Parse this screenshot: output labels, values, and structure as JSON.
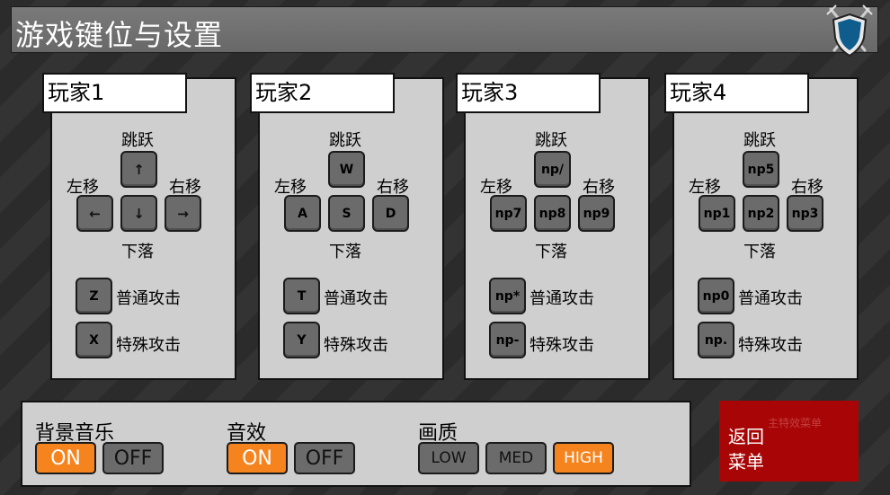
{
  "title": "游戏键位与设置",
  "players": [
    {
      "name": "玩家1",
      "jump_label": "跳跃",
      "left_label": "左移",
      "right_label": "右移",
      "down_label": "下落",
      "keys": {
        "up": "↑",
        "left": "←",
        "down": "↓",
        "right": "→",
        "attack": "Z",
        "special": "X"
      },
      "attack_label": "普通攻击",
      "special_label": "特殊攻击"
    },
    {
      "name": "玩家2",
      "jump_label": "跳跃",
      "left_label": "左移",
      "right_label": "右移",
      "down_label": "下落",
      "keys": {
        "up": "W",
        "left": "A",
        "down": "S",
        "right": "D",
        "attack": "T",
        "special": "Y"
      },
      "attack_label": "普通攻击",
      "special_label": "特殊攻击"
    },
    {
      "name": "玩家3",
      "jump_label": "跳跃",
      "left_label": "左移",
      "right_label": "右移",
      "down_label": "下落",
      "keys": {
        "up": "np/",
        "left": "np7",
        "down": "np8",
        "right": "np9",
        "attack": "np*",
        "special": "np-"
      },
      "attack_label": "普通攻击",
      "special_label": "特殊攻击"
    },
    {
      "name": "玩家4",
      "jump_label": "跳跃",
      "left_label": "左移",
      "right_label": "右移",
      "down_label": "下落",
      "keys": {
        "up": "np5",
        "left": "np1",
        "down": "np2",
        "right": "np3",
        "attack": "np0",
        "special": "np."
      },
      "attack_label": "普通攻击",
      "special_label": "特殊攻击"
    }
  ],
  "settings": {
    "music": {
      "label": "背景音乐",
      "on": "ON",
      "off": "OFF",
      "selected": "ON"
    },
    "sfx": {
      "label": "音效",
      "on": "ON",
      "off": "OFF",
      "selected": "ON"
    },
    "quality": {
      "label": "画质",
      "low": "LOW",
      "med": "MED",
      "high": "HIGH",
      "selected": "HIGH"
    }
  },
  "back": {
    "line1": "返回",
    "line2": "菜单",
    "ghost": "主特效菜单"
  },
  "colors": {
    "accent": "#f5841f",
    "back_button": "#a80606",
    "panel": "#cfcfcf",
    "key": "#6b6b6b",
    "titlebar": "#707070"
  },
  "icons": {
    "logo": "shield-crossed-swords-icon"
  }
}
